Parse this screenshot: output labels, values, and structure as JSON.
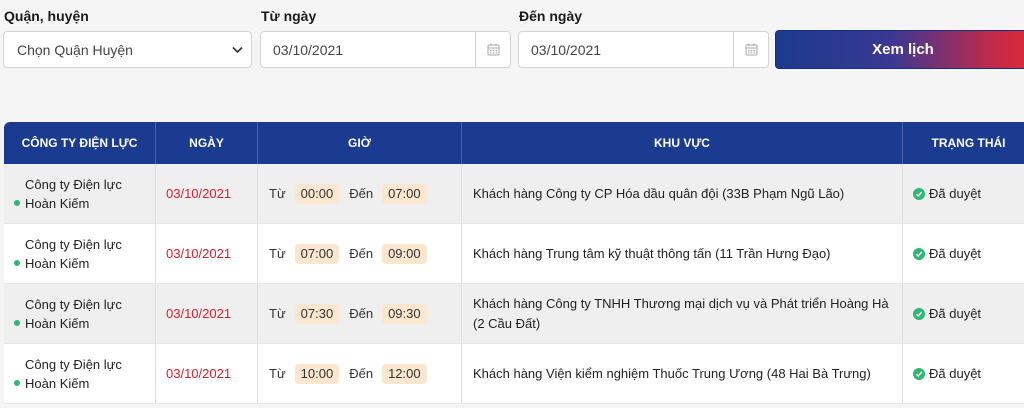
{
  "filters": {
    "district_label": "Quận, huyện",
    "district_value": "Chọn Quận Huyện",
    "from_label": "Từ ngày",
    "from_value": "03/10/2021",
    "to_label": "Đến ngày",
    "to_value": "03/10/2021",
    "view_button": "Xem lịch"
  },
  "table": {
    "headers": [
      "CÔNG TY ĐIỆN LỰC",
      "NGÀY",
      "GIỜ",
      "KHU VỰC",
      "TRẠNG THÁI"
    ],
    "from_word": "Từ",
    "to_word": "Đến",
    "rows": [
      {
        "company": "Công ty Điện lực Hoàn Kiếm",
        "date": "03/10/2021",
        "start": "00:00",
        "end": "07:00",
        "area": "Khách hàng Công ty CP Hóa dầu quân đội (33B Phạm Ngũ Lão)",
        "status": "Đã duyệt"
      },
      {
        "company": "Công ty Điện lực Hoàn Kiếm",
        "date": "03/10/2021",
        "start": "07:00",
        "end": "09:00",
        "area": "Khách hàng Trung tâm kỹ thuật thông tấn (11 Trần Hưng Đạo)",
        "status": "Đã duyệt"
      },
      {
        "company": "Công ty Điện lực Hoàn Kiếm",
        "date": "03/10/2021",
        "start": "07:30",
        "end": "09:30",
        "area": "Khách hàng Công ty TNHH Thương mại dịch vụ và Phát triển Hoàng Hà (2 Cầu Đất)",
        "status": "Đã duyệt"
      },
      {
        "company": "Công ty Điện lực Hoàn Kiếm",
        "date": "03/10/2021",
        "start": "10:00",
        "end": "12:00",
        "area": "Khách hàng Viện kiểm nghiệm Thuốc Trung Ương (48 Hai Bà Trưng)",
        "status": "Đã duyệt"
      }
    ]
  },
  "colors": {
    "header_bg": "#1a3b8f",
    "date_text": "#d8202f",
    "status_green": "#2fb872",
    "time_chip": "#fbe6d0"
  }
}
